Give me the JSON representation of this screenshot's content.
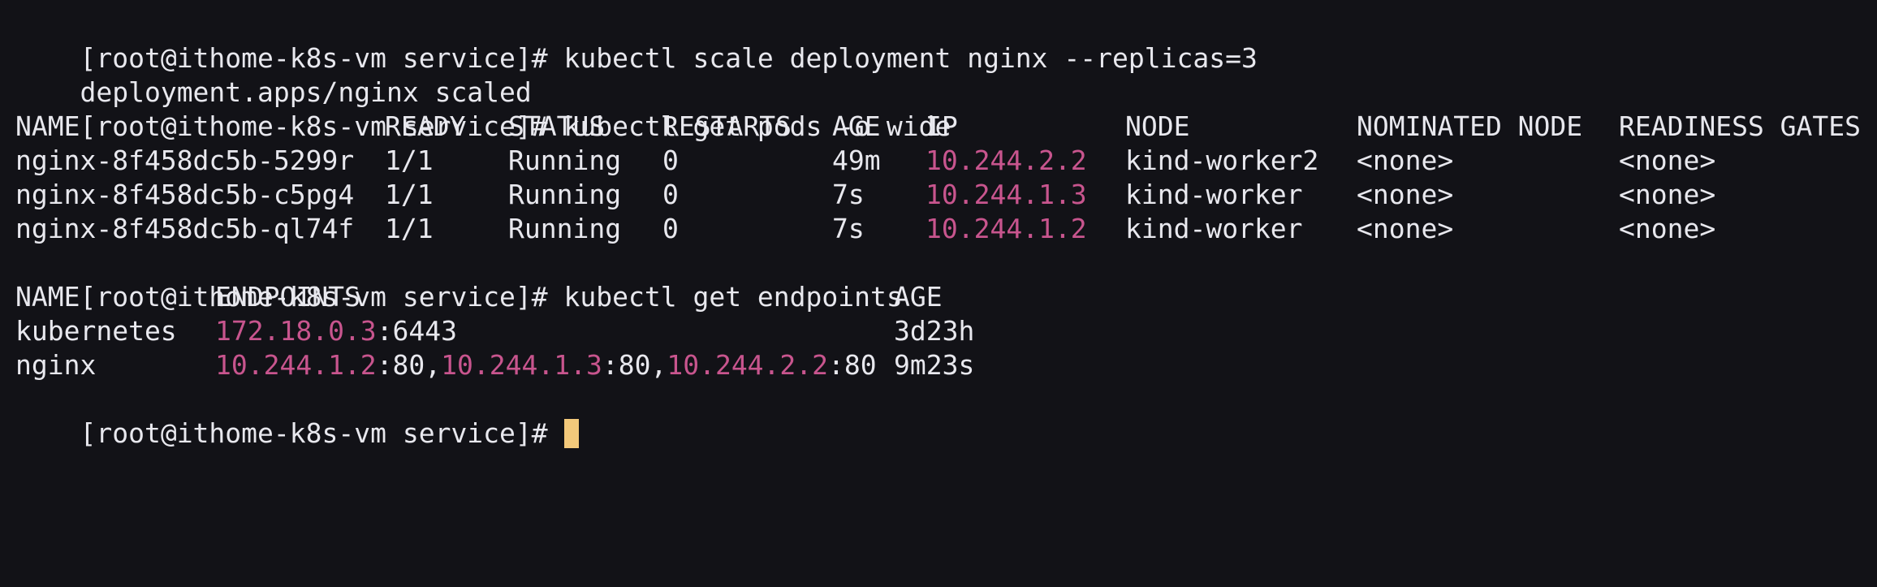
{
  "colors": {
    "background": "#121217",
    "foreground": "#e8e8ee",
    "ip_highlight": "#c8558e",
    "cursor": "#f3c97b"
  },
  "prompt": "[root@ithome-k8s-vm service]# ",
  "commands": {
    "scale": "kubectl scale deployment nginx --replicas=3",
    "get_pods": "kubectl get pods -o wide",
    "get_endpoints": "kubectl get endpoints"
  },
  "scale_output": "deployment.apps/nginx scaled",
  "pods": {
    "headers": [
      "NAME",
      "READY",
      "STATUS",
      "RESTARTS",
      "AGE",
      "IP",
      "NODE",
      "NOMINATED NODE",
      "READINESS GATES"
    ],
    "rows": [
      [
        "nginx-8f458dc5b-5299r",
        "1/1",
        "Running",
        "0",
        "49m",
        "10.244.2.2",
        "kind-worker2",
        "<none>",
        "<none>"
      ],
      [
        "nginx-8f458dc5b-c5pg4",
        "1/1",
        "Running",
        "0",
        "7s",
        "10.244.1.3",
        "kind-worker",
        "<none>",
        "<none>"
      ],
      [
        "nginx-8f458dc5b-ql74f",
        "1/1",
        "Running",
        "0",
        "7s",
        "10.244.1.2",
        "kind-worker",
        "<none>",
        "<none>"
      ]
    ]
  },
  "endpoints": {
    "headers": [
      "NAME",
      "ENDPOINTS",
      "AGE"
    ],
    "kubernetes": {
      "name": "kubernetes",
      "ip": "172.18.0.3",
      "port": ":6443",
      "age": "3d23h"
    },
    "nginx": {
      "name": "nginx",
      "ip1": "10.244.1.2",
      "sep1": ":80,",
      "ip2": "10.244.1.3",
      "sep2": ":80,",
      "ip3": "10.244.2.2",
      "port3": ":80",
      "age": "9m23s"
    }
  }
}
